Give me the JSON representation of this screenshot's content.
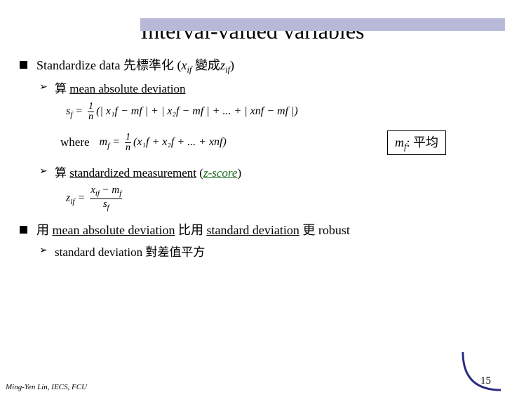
{
  "slide": {
    "title": "Interval-valued variables",
    "bullet1": {
      "pre": "Standardize data  先標準化 (",
      "var1a": "x",
      "var1b": "if",
      "mid": " 變成",
      "var2a": "z",
      "var2b": "if",
      "post": ")"
    },
    "sub1": {
      "pre": "算 ",
      "term": "mean absolute deviation"
    },
    "formula_sf": {
      "lhs": "s",
      "lhs_sub": "f",
      "eq": " = ",
      "frac_num": "1",
      "frac_den": "n",
      "body": "(| x₁f − mf | + | x₂f − mf | + ... + | xnf − mf |)"
    },
    "where": "where",
    "formula_mf": {
      "lhs": "m",
      "lhs_sub": "f",
      "eq": " = ",
      "frac_num": "1",
      "frac_den": "n",
      "body": "(x₁f + x₂f + ... + xnf)"
    },
    "boxed": {
      "var": "m",
      "var_sub": "f",
      "rest": ": 平均"
    },
    "sub2": {
      "pre": "算 ",
      "term": "standardized measurement",
      "paren_open": " (",
      "zscore": "z-score",
      "paren_close": ")"
    },
    "formula_zif": {
      "lhs": "z",
      "lhs_sub": "if",
      "eq": " = ",
      "num_a": "x",
      "num_a_sub": "if",
      "num_minus": " − ",
      "num_b": "m",
      "num_b_sub": "f",
      "den": "s",
      "den_sub": "f"
    },
    "bullet2": {
      "pre": "用 ",
      "term1": "mean absolute deviation",
      "mid": " 比用 ",
      "term2": "standard deviation",
      "post": "  更 robust"
    },
    "sub3": "standard deviation 對差值平方",
    "footer": "Ming-Yen Lin, IECS, FCU",
    "pagenum": "15"
  }
}
